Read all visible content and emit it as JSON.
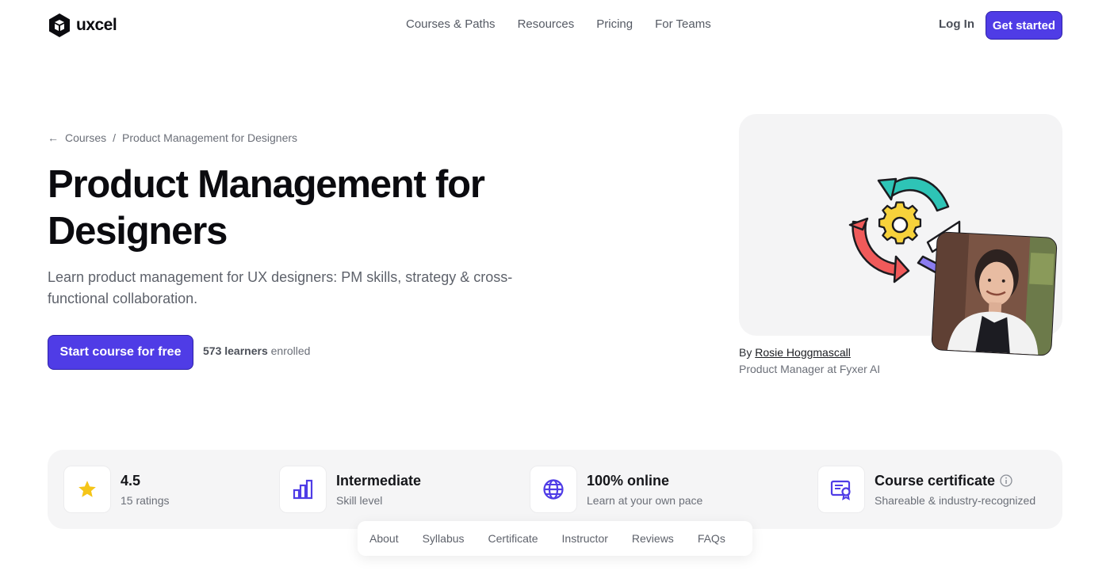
{
  "header": {
    "logo_text": "uxcel",
    "nav": [
      "Courses & Paths",
      "Resources",
      "Pricing",
      "For Teams"
    ],
    "login_label": "Log In",
    "cta_label": "Get started"
  },
  "breadcrumb": {
    "back_label": "Courses",
    "separator": "/",
    "current": "Product Management for Designers"
  },
  "hero": {
    "title": "Product Management for Designers",
    "subtitle": "Learn product management for UX designers: PM skills, strategy & cross-functional collaboration.",
    "start_label": "Start course for free",
    "learners_count": "573 learners",
    "learners_suffix": " enrolled"
  },
  "author": {
    "prefix": "By ",
    "name": "Rosie Hoggmascall",
    "role": "Product Manager at Fyxer AI"
  },
  "stats": [
    {
      "icon": "star-icon",
      "title": "4.5",
      "sub": "15 ratings"
    },
    {
      "icon": "bar-chart-icon",
      "title": "Intermediate",
      "sub": "Skill level"
    },
    {
      "icon": "globe-icon",
      "title": "100% online",
      "sub": "Learn at your own pace"
    },
    {
      "icon": "certificate-icon",
      "title": "Course certificate",
      "sub": "Shareable & industry-recognized"
    }
  ],
  "tabs": [
    "About",
    "Syllabus",
    "Certificate",
    "Instructor",
    "Reviews",
    "FAQs"
  ],
  "colors": {
    "accent": "#4f3ce6",
    "star": "#f5c518",
    "icon_purple": "#4f3ce6"
  }
}
